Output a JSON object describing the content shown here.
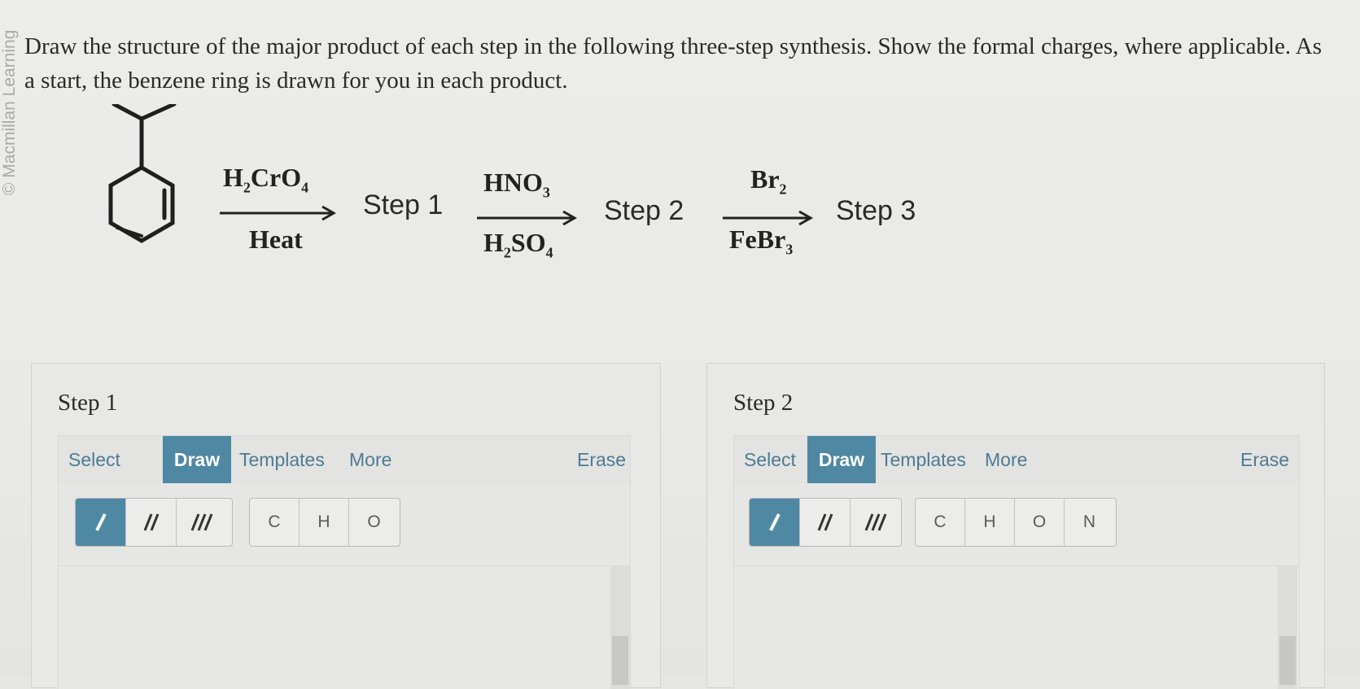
{
  "watermark": "© Macmillan Learning",
  "question": "Draw the structure of the major product of each step in the following three-step synthesis. Show the formal charges, where applicable. As a start, the benzene ring is drawn for you in each product.",
  "scheme": {
    "arrow1": {
      "top": "H",
      "top_sub1": "2",
      "top_mid": "CrO",
      "top_sub2": "4",
      "bottom": "Heat"
    },
    "step1_label": "Step 1",
    "arrow2": {
      "top": "HNO",
      "top_sub": "3",
      "bottom": "H",
      "bottom_sub1": "2",
      "bottom_mid": "SO",
      "bottom_sub2": "4"
    },
    "step2_label": "Step 2",
    "arrow3": {
      "top": "Br",
      "top_sub": "2",
      "bottom": "FeBr",
      "bottom_sub": "3"
    },
    "step3_label": "Step 3"
  },
  "panels": [
    {
      "title": "Step 1",
      "toolbar": {
        "select": "Select",
        "draw": "Draw",
        "templates": "Templates",
        "more": "More",
        "erase": "Erase"
      },
      "bonds": [
        "single-bond-icon",
        "double-bond-icon",
        "triple-bond-icon"
      ],
      "atoms": [
        "C",
        "H",
        "O"
      ]
    },
    {
      "title": "Step 2",
      "toolbar": {
        "select": "Select",
        "draw": "Draw",
        "templates": "Templates",
        "more": "More",
        "erase": "Erase"
      },
      "bonds": [
        "single-bond-icon",
        "double-bond-icon",
        "triple-bond-icon"
      ],
      "atoms": [
        "C",
        "H",
        "O",
        "N"
      ]
    }
  ],
  "colors": {
    "accent": "#4f88a3",
    "link": "#4d7b94"
  }
}
